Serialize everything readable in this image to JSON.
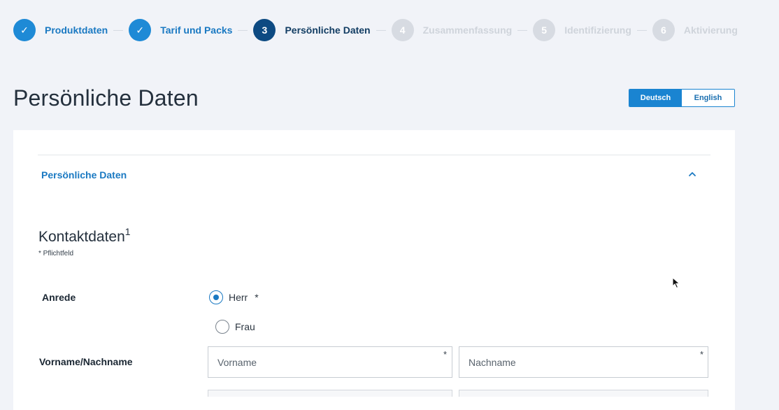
{
  "stepper": {
    "steps": [
      {
        "number": "✓",
        "label": "Produktdaten",
        "state": "done"
      },
      {
        "number": "✓",
        "label": "Tarif und Packs",
        "state": "done"
      },
      {
        "number": "3",
        "label": "Persönliche Daten",
        "state": "active"
      },
      {
        "number": "4",
        "label": "Zusammenfassung",
        "state": "todo"
      },
      {
        "number": "5",
        "label": "Identifizierung",
        "state": "todo"
      },
      {
        "number": "6",
        "label": "Aktivierung",
        "state": "todo"
      }
    ]
  },
  "page": {
    "title": "Persönliche Daten"
  },
  "language": {
    "deutsch": "Deutsch",
    "english": "English",
    "selected": "Deutsch"
  },
  "section": {
    "header": "Persönliche Daten",
    "expanded": true
  },
  "contact": {
    "title": "Kontaktdaten",
    "footnote": "1",
    "required_note": "* Pflichtfeld"
  },
  "form": {
    "salutation": {
      "label": "Anrede",
      "options": [
        {
          "label": "Herr",
          "checked": true,
          "required_marker": "*"
        },
        {
          "label": "Frau",
          "checked": false
        }
      ]
    },
    "name": {
      "label": "Vorname/Nachname",
      "first_placeholder": "Vorname",
      "last_placeholder": "Nachname",
      "first_value": "",
      "last_value": "",
      "required_marker": "*"
    }
  },
  "colors": {
    "accent": "#1a84d1",
    "active_step": "#0d4a82",
    "background": "#f1f3f8"
  }
}
